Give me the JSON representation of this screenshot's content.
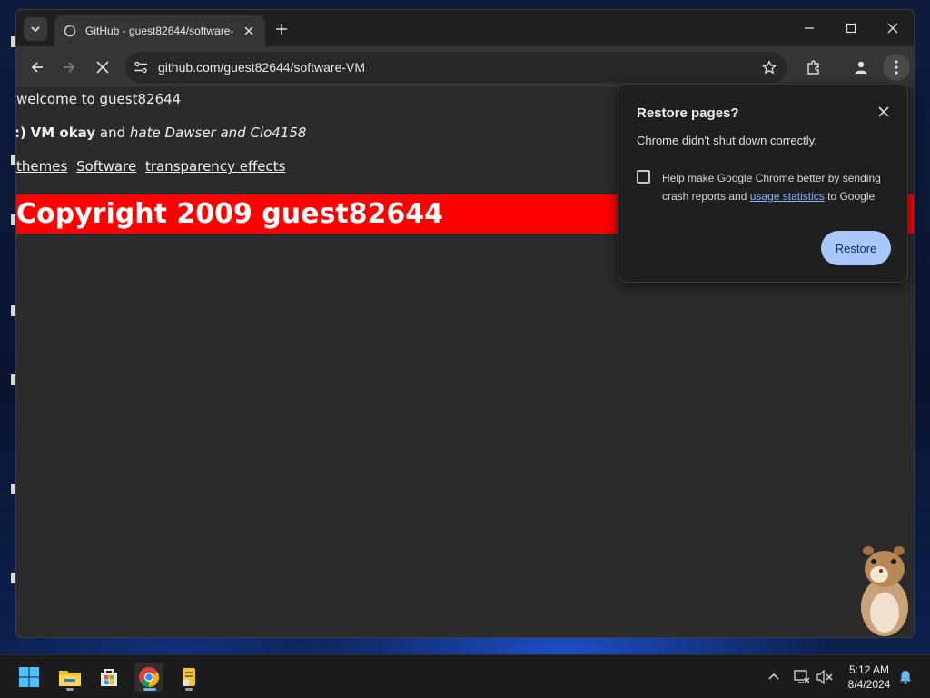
{
  "browser": {
    "tab_title": "GitHub - guest82644/software-",
    "url": "github.com/guest82644/software-VM"
  },
  "page": {
    "welcome": "welcome to guest82644",
    "line2_prefix": ":)",
    "line2_bold": "VM okay",
    "line2_and": "and",
    "line2_italic": "hate Dawser and Cio4158",
    "links": [
      "themes",
      "Software",
      "transparency effects"
    ],
    "copyright": "Copyright 2009 guest82644"
  },
  "popup": {
    "title": "Restore pages?",
    "message": "Chrome didn't shut down correctly.",
    "checkbox_prefix": "Help make Google Chrome better by sending crash reports and",
    "checkbox_link": "usage statistics",
    "checkbox_suffix": "to Google",
    "checkbox_checked": false,
    "restore_label": "Restore"
  },
  "taskbar": {
    "apps": [
      "start-icon",
      "file-explorer-icon",
      "microsoft-store-icon",
      "chrome-icon",
      "notepad-icon"
    ],
    "time": "5:12 AM",
    "date": "8/4/2024"
  },
  "colors": {
    "banner": "#ff0000",
    "link": "#8ab4f8",
    "restore_button": "#a8c7fa"
  }
}
